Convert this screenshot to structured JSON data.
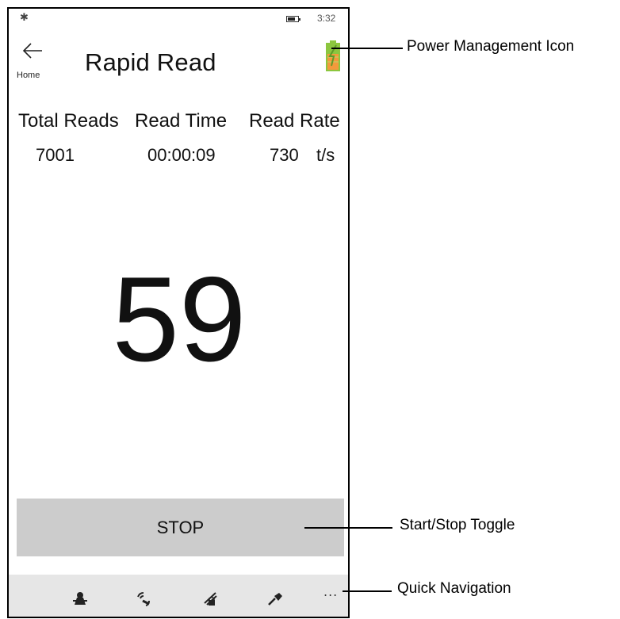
{
  "status_bar": {
    "bluetooth_icon": "bluetooth-icon",
    "battery_icon": "battery-icon",
    "time": "3:32"
  },
  "header": {
    "back_label": "Home",
    "title": "Rapid Read",
    "power_icon": "battery-power-icon"
  },
  "stats": {
    "total_reads_label": "Total Reads",
    "read_time_label": "Read Time",
    "read_rate_label": "Read Rate",
    "total_reads_value": "7001",
    "read_time_value": "00:00:09",
    "read_rate_value": "730",
    "read_rate_unit": "t/s"
  },
  "unique_count": "59",
  "stop_label": "STOP",
  "bottom_nav": {
    "items": [
      "inventory-icon",
      "rfid-locate-icon",
      "access-icon",
      "settings-icon"
    ],
    "more": "..."
  },
  "callouts": {
    "power": "Power Management Icon",
    "toggle": "Start/Stop Toggle",
    "nav": "Quick Navigation"
  },
  "colors": {
    "battery_green": "#8cc63f",
    "battery_orange": "#f39a3c",
    "button_gray": "#cccccc",
    "nav_gray": "#e6e6e6"
  }
}
